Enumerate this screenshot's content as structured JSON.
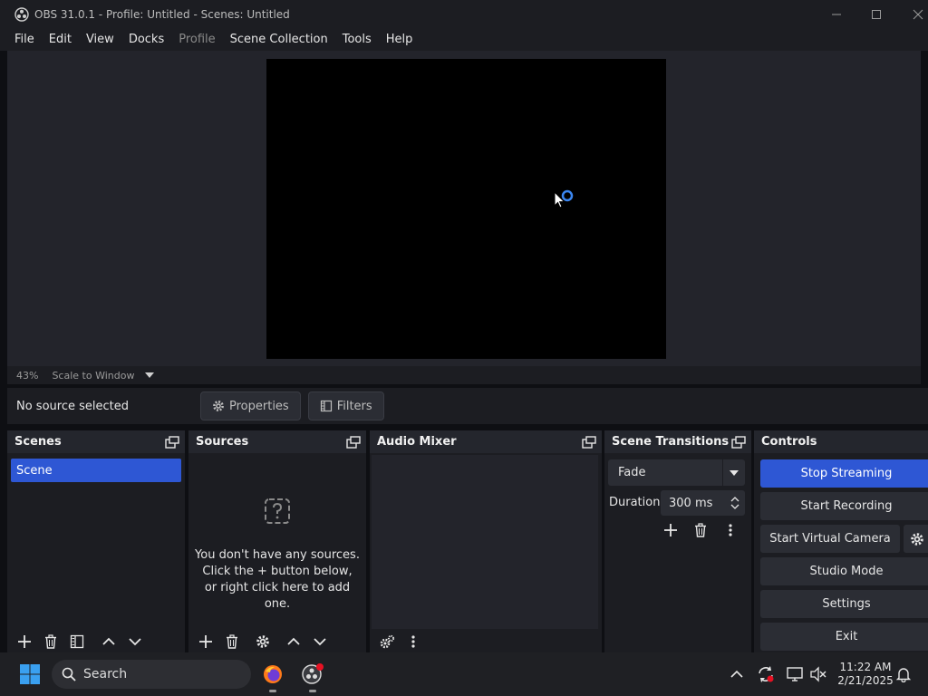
{
  "window": {
    "title": "OBS 31.0.1 - Profile: Untitled - Scenes: Untitled"
  },
  "menu": [
    "File",
    "Edit",
    "View",
    "Docks",
    "Profile",
    "Scene Collection",
    "Tools",
    "Help"
  ],
  "menu_disabled_index": 4,
  "preview": {
    "zoom": "43%",
    "scale_mode": "Scale to Window"
  },
  "context_bar": {
    "no_source": "No source selected",
    "properties": "Properties",
    "filters": "Filters"
  },
  "docks": {
    "scenes": {
      "title": "Scenes",
      "items": [
        "Scene"
      ]
    },
    "sources": {
      "title": "Sources",
      "empty_line1": "You don't have any sources.",
      "empty_line2": "Click the + button below,",
      "empty_line3": "or right click here to add one."
    },
    "audio_mixer": {
      "title": "Audio Mixer"
    },
    "scene_transitions": {
      "title": "Scene Transitions",
      "transition": "Fade",
      "duration_label": "Duration",
      "duration_value": "300 ms"
    },
    "controls": {
      "title": "Controls",
      "stop_streaming": "Stop Streaming",
      "start_recording": "Start Recording",
      "start_virtual_camera": "Start Virtual Camera",
      "studio_mode": "Studio Mode",
      "settings": "Settings",
      "exit": "Exit"
    }
  },
  "taskbar": {
    "search_placeholder": "Search",
    "time": "11:22 AM",
    "date": "2/21/2025"
  },
  "colors": {
    "accent": "#2e57d4",
    "background": "#1c1d22",
    "panel": "#23242b"
  }
}
